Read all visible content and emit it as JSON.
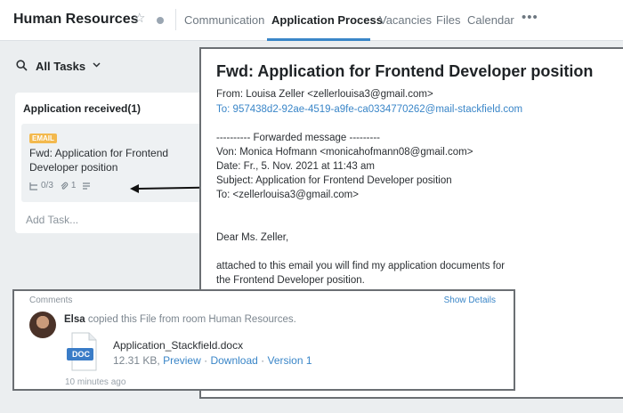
{
  "header": {
    "room_title": "Human Resources",
    "tabs": [
      {
        "label": "Communication"
      },
      {
        "label": "Application Process"
      },
      {
        "label": "Vacancies"
      },
      {
        "label": "Files"
      },
      {
        "label": "Calendar"
      }
    ],
    "more_label": "•••",
    "active_tab": "Application Process",
    "accent_color": "#3a86c8"
  },
  "filter": {
    "label": "All Tasks"
  },
  "column": {
    "title": "Application received(1)",
    "card": {
      "badge": "EMAIL",
      "title": "Fwd: Application for Frontend Developer position",
      "subtasks": "0/3",
      "attachments": "1"
    },
    "add_task": "Add Task..."
  },
  "email": {
    "subject": "Fwd: Application for Frontend Developer position",
    "from": "From: Louisa Zeller <zellerlouisa3@gmail.com>",
    "to_prefix": "To: ",
    "to_address": "957438d2-92ae-4519-a9fe-ca0334770262@mail-stackfield.com",
    "forward_header": "---------- Forwarded message ---------",
    "fwd_from": "Von: Monica Hofmann <monicahofmann08@gmail.com>",
    "fwd_date": "Date: Fr., 5. Nov. 2021 at 11:43 am",
    "fwd_subject": "Subject: Application for Frontend Developer position",
    "fwd_to": "To: <zellerlouisa3@gmail.com>",
    "greeting": "Dear Ms. Zeller,",
    "body_1": "attached to this email you will find my application documents for",
    "body_2": "the Frontend Developer position."
  },
  "comments": {
    "label": "Comments",
    "show_details": "Show Details",
    "user": "Elsa",
    "action": " copied this File from room Human Resources.",
    "file_type": "DOC",
    "file_name": "Application_Stackfield.docx",
    "file_size": "12.31 KB,",
    "preview": "Preview",
    "download": "Download",
    "version": "Version 1",
    "bullet": "·",
    "time_ago": "10 minutes ago"
  }
}
